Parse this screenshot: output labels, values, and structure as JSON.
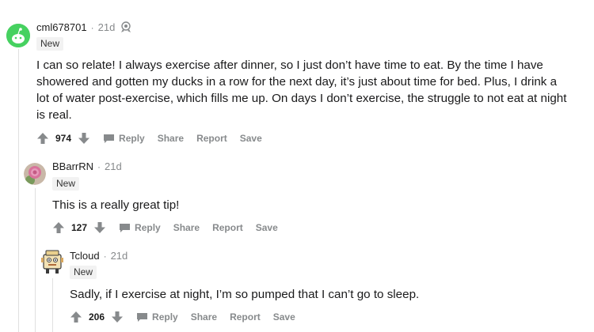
{
  "comments": [
    {
      "username": "cml678701",
      "age": "21d",
      "badge": "New",
      "body": "I can so relate! I always exercise after dinner, so I just don’t have time to eat. By the time I have showered and gotten my ducks in a row for the next day, it’s just about time for bed. Plus, I drink a lot of water post-exercise, which fills me up. On days I don’t exercise, the struggle to not eat at night is real.",
      "score": "974",
      "actions": {
        "reply": "Reply",
        "share": "Share",
        "report": "Report",
        "save": "Save"
      },
      "avatar_icon": "snoo-avatar-icon",
      "flair_icon": "award-icon"
    },
    {
      "username": "BBarrRN",
      "age": "21d",
      "badge": "New",
      "body": "This is a really great tip!",
      "score": "127",
      "actions": {
        "reply": "Reply",
        "share": "Share",
        "report": "Report",
        "save": "Save"
      },
      "avatar_icon": "rose-avatar-icon"
    },
    {
      "username": "Tcloud",
      "age": "21d",
      "badge": "New",
      "body": "Sadly, if I exercise at night, I’m so pumped that I can’t go to sleep.",
      "score": "206",
      "actions": {
        "reply": "Reply",
        "share": "Share",
        "report": "Report",
        "save": "Save"
      },
      "avatar_icon": "robot-avatar-icon"
    }
  ],
  "colors": {
    "meta_gray": "#878a8c",
    "text": "#1a1a1b",
    "thread_line": "#e0e0e0",
    "badge_bg": "#f2f2f2",
    "snoo_green": "#46d160"
  }
}
